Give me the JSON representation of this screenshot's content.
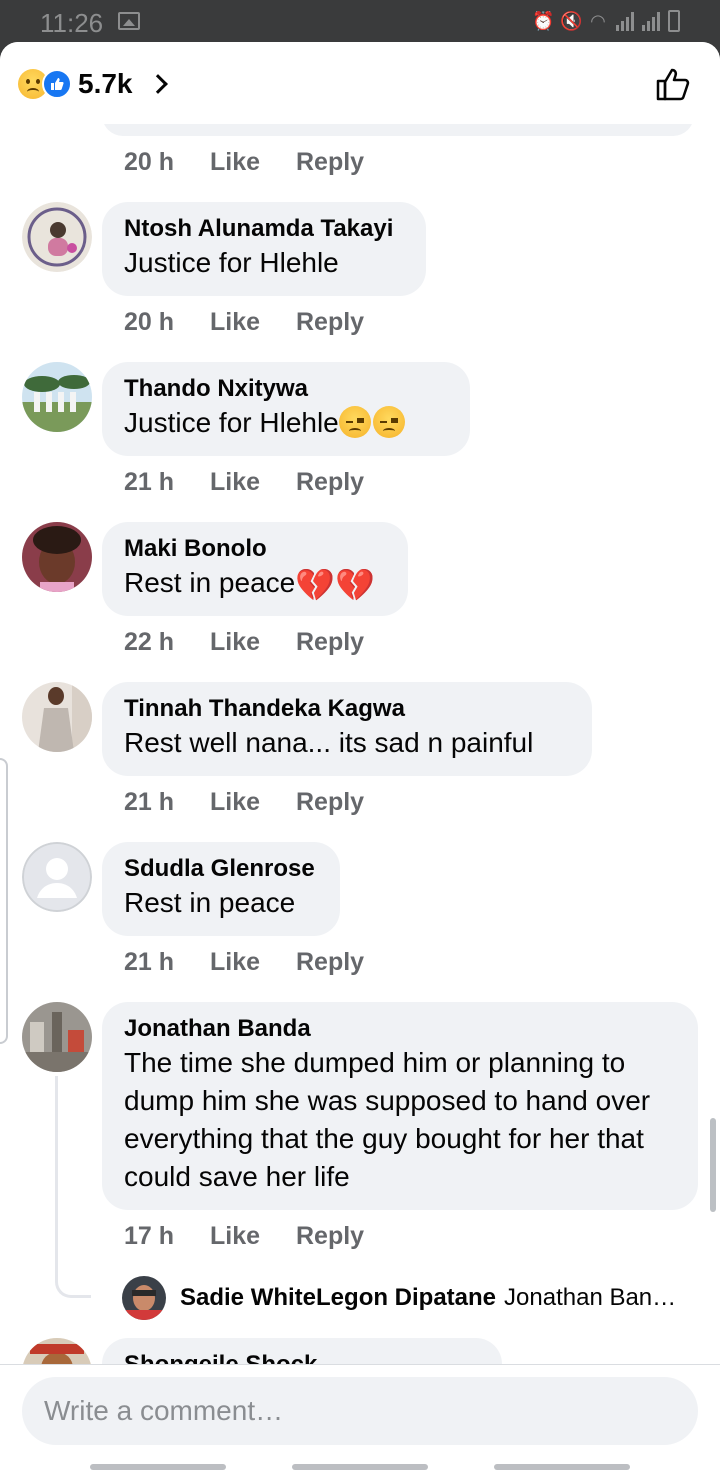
{
  "status_bar": {
    "time": "11:26"
  },
  "header": {
    "reaction_count": "5.7k"
  },
  "action_labels": {
    "like": "Like",
    "reply": "Reply"
  },
  "comments": [
    {
      "author": "",
      "text": "",
      "time": "20 h"
    },
    {
      "author": "Ntosh Alunamda Takayi",
      "text": "Justice  for Hlehle",
      "time": "20 h"
    },
    {
      "author": "Thando Nxitywa",
      "text": "Justice  for Hlehle",
      "time": "21 h"
    },
    {
      "author": "Maki Bonolo",
      "text": "Rest in peace",
      "time": "22 h"
    },
    {
      "author": "Tinnah Thandeka Kagwa",
      "text": "Rest well nana... its sad n painful",
      "time": "21 h"
    },
    {
      "author": "Sdudla Glenrose",
      "text": "Rest in peace",
      "time": "21 h"
    },
    {
      "author": "Jonathan Banda",
      "text": "The time she dumped him or planning to dump him she was supposed to hand over everything that the guy bought for her that could save her life",
      "time": "17 h"
    }
  ],
  "reply_preview": {
    "author": "Sadie WhiteLegon Dipatane",
    "snippet": "Jonathan Ban…"
  },
  "partial_comment": {
    "author": "Shongeile Shock"
  },
  "composer": {
    "placeholder": "Write a comment…"
  }
}
